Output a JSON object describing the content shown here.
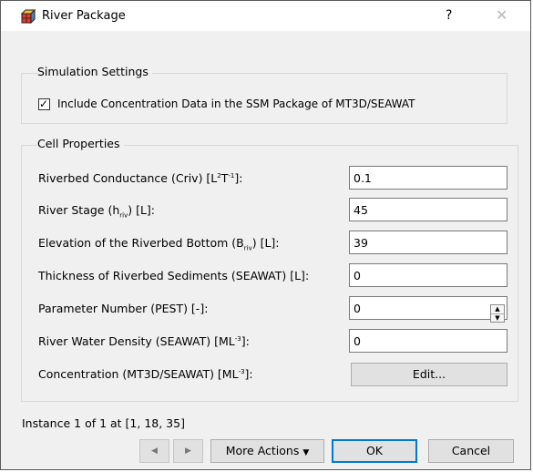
{
  "window": {
    "title": "River Package",
    "help_glyph": "?",
    "close_glyph": "✕",
    "icon": "river-package-icon"
  },
  "simulation_settings": {
    "title": "Simulation Settings",
    "checkbox_label": "Include Concentration Data in the SSM Package of MT3D/SEAWAT",
    "checked": true
  },
  "cell_properties": {
    "title": "Cell Properties",
    "rows": [
      {
        "label_main": "Riverbed Conductance (Criv) [L",
        "sup1": "2",
        "mid": "T",
        "sup2": "-1",
        "tail": "]:",
        "value": "0.1"
      },
      {
        "label_pre": "River Stage (h",
        "sub": "riv",
        "label_post": ") [L]:",
        "value": "45"
      },
      {
        "label_pre": "Elevation of the Riverbed Bottom (B",
        "sub": "riv",
        "label_post": ") [L]:",
        "value": "39"
      },
      {
        "label": "Thickness of Riverbed Sediments (SEAWAT) [L]:",
        "value": "0"
      },
      {
        "label": "Parameter Number (PEST) [-]:",
        "value": "0"
      },
      {
        "label_pre": "River Water Density (SEAWAT) [ML",
        "sup": "-3",
        "label_post": "]:",
        "value": "0"
      },
      {
        "label_pre": "Concentration (MT3D/SEAWAT) [ML",
        "sup": "-3",
        "label_post": "]:",
        "button": "Edit..."
      }
    ]
  },
  "footer": {
    "instance_text": "Instance 1 of 1 at [1, 18, 35]",
    "prev_glyph": "◀",
    "next_glyph": "▶",
    "more_actions": "More Actions",
    "more_actions_arrow": "▼",
    "ok": "OK",
    "cancel": "Cancel"
  }
}
